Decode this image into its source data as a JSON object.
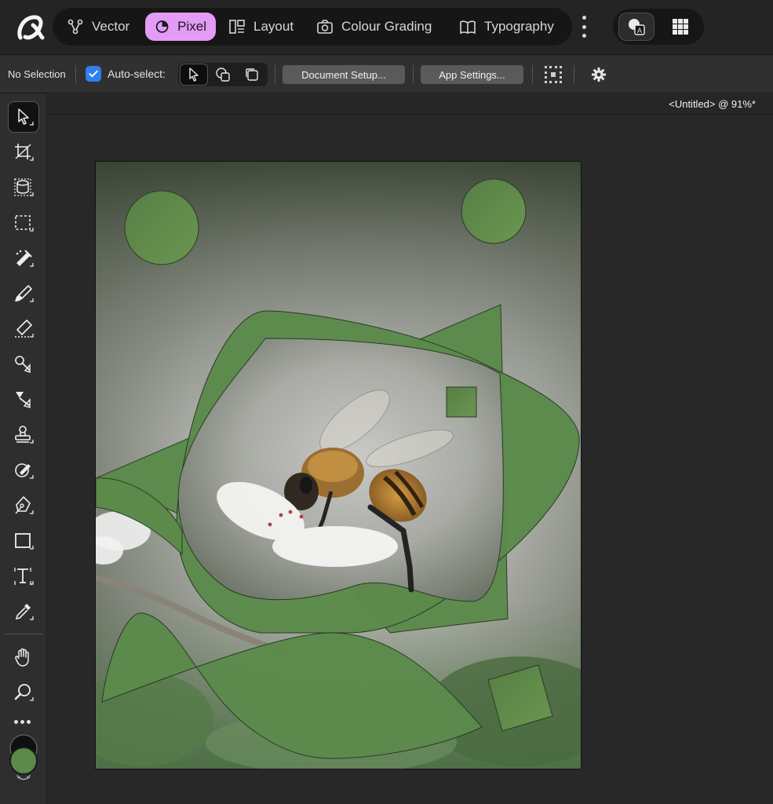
{
  "app": {
    "logo": "affinity-logo"
  },
  "personas": [
    {
      "label": "Vector",
      "icon": "vector-persona-icon"
    },
    {
      "label": "Pixel",
      "icon": "pixel-persona-icon",
      "active": true
    },
    {
      "label": "Layout",
      "icon": "layout-persona-icon"
    },
    {
      "label": "Colour Grading",
      "icon": "camera-icon"
    },
    {
      "label": "Typography",
      "icon": "book-icon"
    }
  ],
  "context_toolbar": {
    "selection_status": "No Selection",
    "auto_select_label": "Auto-select:",
    "auto_select_checked": true,
    "document_setup": "Document Setup...",
    "app_settings": "App Settings..."
  },
  "document": {
    "title": "<Untitled> @ 91%*",
    "zoom": "91%"
  },
  "tools": [
    "move-tool-icon",
    "crop-tool-icon",
    "selection-brush-icon",
    "marquee-tool-icon",
    "flood-select-icon",
    "paint-brush-icon",
    "erase-brush-icon",
    "dodge-brush-icon",
    "burn-brush-icon",
    "clone-stamp-icon",
    "inpainting-brush-icon",
    "pen-tool-icon",
    "rectangle-tool-icon",
    "artistic-text-icon",
    "colour-picker-icon",
    "hand-tool-icon",
    "zoom-tool-icon"
  ],
  "colours": {
    "accent": "#e29cf5",
    "checkbox": "#2f80ed",
    "shape_green": "#5b8a4b",
    "fill_well": "#5b8a4b",
    "stroke_well": "#101010"
  }
}
